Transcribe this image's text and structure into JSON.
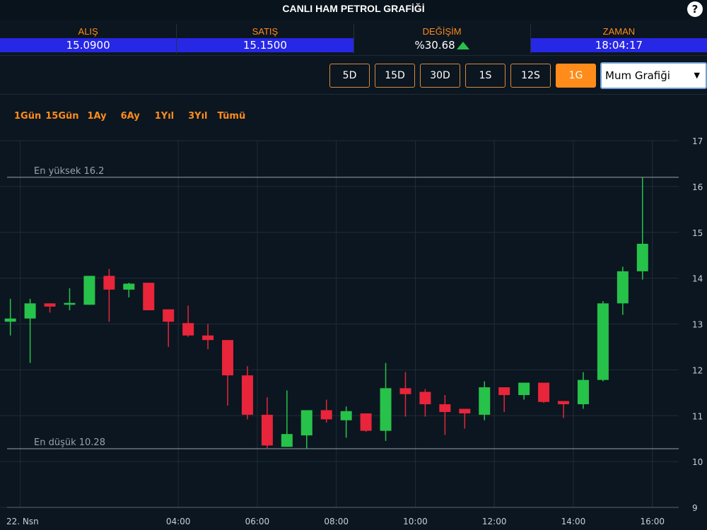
{
  "header": {
    "title": "CANLI HAM PETROL GRAFİĞİ",
    "help_label": "?"
  },
  "quotes": [
    {
      "label": "ALIŞ",
      "value": "15.0900"
    },
    {
      "label": "SATIŞ",
      "value": "15.1500"
    },
    {
      "label": "DEĞİŞİM",
      "value": "%30.68"
    },
    {
      "label": "ZAMAN",
      "value": "18:04:17"
    }
  ],
  "colors": {
    "accent": "#ff8c1a",
    "up": "#27c24a",
    "down": "#e8253a",
    "quote_bg": "#2727e6",
    "background": "#0b1620"
  },
  "change_icon": "up-triangle-icon",
  "interval_buttons": [
    "5D",
    "15D",
    "30D",
    "1S",
    "12S",
    "1G"
  ],
  "selected_interval": "1G",
  "chart_type_select": {
    "value": "Mum Grafiği",
    "arrow": "▼"
  },
  "range_links": [
    "1Gün",
    "15Gün",
    "1Ay",
    "6Ay",
    "1Yıl",
    "3Yıl",
    "Tümü"
  ],
  "chart_data": {
    "type": "candlestick",
    "title": "",
    "ylim": [
      9,
      17
    ],
    "y_ticks": [
      "9",
      "10",
      "11",
      "12",
      "13",
      "14",
      "15",
      "16",
      "17"
    ],
    "x_range": [
      "2022-04-21T23:40",
      "2022-04-22T16:40"
    ],
    "x_ticks": [
      {
        "time": "2022-04-22T00:00",
        "label": "22. Nsn"
      },
      {
        "time": "2022-04-22T04:00",
        "label": "04:00"
      },
      {
        "time": "2022-04-22T06:00",
        "label": "06:00"
      },
      {
        "time": "2022-04-22T08:00",
        "label": "08:00"
      },
      {
        "time": "2022-04-22T10:00",
        "label": "10:00"
      },
      {
        "time": "2022-04-22T12:00",
        "label": "12:00"
      },
      {
        "time": "2022-04-22T14:00",
        "label": "14:00"
      },
      {
        "time": "2022-04-22T16:00",
        "label": "16:00"
      }
    ],
    "grid": true,
    "annotations": [
      {
        "label": "En yüksek 16.2",
        "value": 16.2
      },
      {
        "label": "En düşük 10.28",
        "value": 10.28
      }
    ],
    "candles": [
      {
        "time": "2022-04-21T23:45",
        "open": 13.05,
        "high": 13.55,
        "low": 12.75,
        "close": 13.12
      },
      {
        "time": "2022-04-22T00:15",
        "open": 13.12,
        "high": 13.55,
        "low": 12.15,
        "close": 13.45
      },
      {
        "time": "2022-04-22T00:45",
        "open": 13.45,
        "high": 13.45,
        "low": 13.25,
        "close": 13.38
      },
      {
        "time": "2022-04-22T01:15",
        "open": 13.42,
        "high": 13.78,
        "low": 13.3,
        "close": 13.46
      },
      {
        "time": "2022-04-22T01:45",
        "open": 13.42,
        "high": 14.05,
        "low": 13.42,
        "close": 14.05
      },
      {
        "time": "2022-04-22T02:15",
        "open": 14.05,
        "high": 14.2,
        "low": 13.05,
        "close": 13.75
      },
      {
        "time": "2022-04-22T02:45",
        "open": 13.75,
        "high": 13.9,
        "low": 13.58,
        "close": 13.88
      },
      {
        "time": "2022-04-22T03:15",
        "open": 13.9,
        "high": 13.9,
        "low": 13.3,
        "close": 13.3
      },
      {
        "time": "2022-04-22T03:45",
        "open": 13.32,
        "high": 13.32,
        "low": 12.5,
        "close": 13.05
      },
      {
        "time": "2022-04-22T04:15",
        "open": 13.02,
        "high": 13.4,
        "low": 12.72,
        "close": 12.75
      },
      {
        "time": "2022-04-22T04:45",
        "open": 12.75,
        "high": 13.0,
        "low": 12.45,
        "close": 12.65
      },
      {
        "time": "2022-04-22T05:15",
        "open": 12.65,
        "high": 12.65,
        "low": 11.22,
        "close": 11.88
      },
      {
        "time": "2022-04-22T05:45",
        "open": 11.88,
        "high": 12.08,
        "low": 10.92,
        "close": 11.02
      },
      {
        "time": "2022-04-22T06:15",
        "open": 11.02,
        "high": 11.4,
        "low": 10.28,
        "close": 10.35
      },
      {
        "time": "2022-04-22T06:45",
        "open": 10.32,
        "high": 11.55,
        "low": 10.32,
        "close": 10.6
      },
      {
        "time": "2022-04-22T07:15",
        "open": 10.57,
        "high": 11.1,
        "low": 10.27,
        "close": 11.12
      },
      {
        "time": "2022-04-22T07:45",
        "open": 11.12,
        "high": 11.35,
        "low": 10.85,
        "close": 10.92
      },
      {
        "time": "2022-04-22T08:15",
        "open": 10.9,
        "high": 11.2,
        "low": 10.52,
        "close": 11.1
      },
      {
        "time": "2022-04-22T08:45",
        "open": 11.05,
        "high": 11.05,
        "low": 10.65,
        "close": 10.67
      },
      {
        "time": "2022-04-22T09:15",
        "open": 10.67,
        "high": 12.15,
        "low": 10.45,
        "close": 11.6
      },
      {
        "time": "2022-04-22T09:45",
        "open": 11.6,
        "high": 11.95,
        "low": 10.98,
        "close": 11.47
      },
      {
        "time": "2022-04-22T10:15",
        "open": 11.52,
        "high": 11.58,
        "low": 10.98,
        "close": 11.25
      },
      {
        "time": "2022-04-22T10:45",
        "open": 11.25,
        "high": 11.45,
        "low": 10.58,
        "close": 11.08
      },
      {
        "time": "2022-04-22T11:15",
        "open": 11.15,
        "high": 11.15,
        "low": 10.72,
        "close": 11.05
      },
      {
        "time": "2022-04-22T11:45",
        "open": 11.02,
        "high": 11.75,
        "low": 10.9,
        "close": 11.62
      },
      {
        "time": "2022-04-22T12:15",
        "open": 11.62,
        "high": 11.62,
        "low": 11.08,
        "close": 11.45
      },
      {
        "time": "2022-04-22T12:45",
        "open": 11.45,
        "high": 11.72,
        "low": 11.35,
        "close": 11.72
      },
      {
        "time": "2022-04-22T13:15",
        "open": 11.72,
        "high": 11.72,
        "low": 11.28,
        "close": 11.3
      },
      {
        "time": "2022-04-22T13:45",
        "open": 11.32,
        "high": 11.32,
        "low": 10.95,
        "close": 11.25
      },
      {
        "time": "2022-04-22T14:15",
        "open": 11.25,
        "high": 11.95,
        "low": 11.15,
        "close": 11.78
      },
      {
        "time": "2022-04-22T14:45",
        "open": 11.78,
        "high": 13.5,
        "low": 11.75,
        "close": 13.45
      },
      {
        "time": "2022-04-22T15:15",
        "open": 13.45,
        "high": 14.25,
        "low": 13.2,
        "close": 14.15
      },
      {
        "time": "2022-04-22T15:45",
        "open": 14.15,
        "high": 16.2,
        "low": 13.97,
        "close": 14.75
      }
    ]
  }
}
